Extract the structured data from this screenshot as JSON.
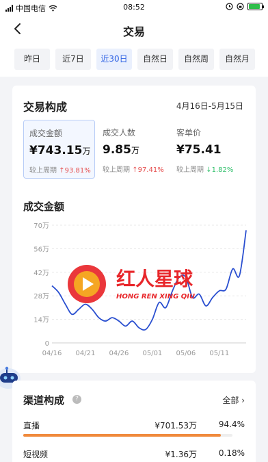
{
  "status_bar": {
    "carrier": "中国电信",
    "time": "08:52"
  },
  "nav": {
    "title": "交易"
  },
  "tabs": [
    {
      "label": "昨日",
      "active": false
    },
    {
      "label": "近7日",
      "active": false
    },
    {
      "label": "近30日",
      "active": true
    },
    {
      "label": "自然日",
      "active": false
    },
    {
      "label": "自然周",
      "active": false
    },
    {
      "label": "自然月",
      "active": false
    }
  ],
  "composition": {
    "title": "交易构成",
    "date_range": "4月16日-5月15日",
    "metrics": [
      {
        "label": "成交金额",
        "value": "¥743.15",
        "unit": "万",
        "compare_label": "较上周期",
        "direction": "up",
        "change": "93.81%",
        "selected": true
      },
      {
        "label": "成交人数",
        "value": "9.85",
        "unit": "万",
        "compare_label": "较上周期",
        "direction": "up",
        "change": "97.41%",
        "selected": false
      },
      {
        "label": "客单价",
        "value": "¥75.41",
        "unit": "",
        "compare_label": "较上周期",
        "direction": "down",
        "change": "1.82%",
        "selected": false
      }
    ]
  },
  "chart_data": {
    "type": "line",
    "title": "成交金额",
    "y_tick_labels": [
      "0",
      "14万",
      "28万",
      "42万",
      "56万",
      "70万"
    ],
    "x_tick_labels": [
      "04/16",
      "04/21",
      "04/26",
      "05/01",
      "05/06",
      "05/11"
    ],
    "ylim": [
      0,
      70
    ],
    "y_unit": "万",
    "x": [
      "04/16",
      "04/17",
      "04/18",
      "04/19",
      "04/20",
      "04/21",
      "04/22",
      "04/23",
      "04/24",
      "04/25",
      "04/26",
      "04/27",
      "04/28",
      "04/29",
      "04/30",
      "05/01",
      "05/02",
      "05/03",
      "05/04",
      "05/05",
      "05/06",
      "05/07",
      "05/08",
      "05/09",
      "05/10",
      "05/11",
      "05/12",
      "05/13",
      "05/14",
      "05/15"
    ],
    "series": [
      {
        "values": [
          34,
          30,
          23,
          17,
          20,
          23,
          20,
          15,
          13,
          15,
          13,
          10,
          13,
          9,
          8,
          14,
          24,
          21,
          31,
          39,
          39,
          27,
          29,
          22,
          27,
          31,
          32,
          44,
          40,
          67
        ]
      }
    ],
    "grid": true,
    "line_color": "#2a4fd0"
  },
  "watermark": {
    "text": "红人星球",
    "subtext": "HONG REN XING QIU"
  },
  "channels": {
    "title": "渠道构成",
    "help_icon": "question-icon",
    "all_label": "全部",
    "rows": [
      {
        "name": "直播",
        "amount": "¥701.53万",
        "share": "94.4%",
        "share_value": 0.944
      },
      {
        "name": "短视频",
        "amount": "¥1.36万",
        "share": "0.18%",
        "share_value": 0.0018
      }
    ]
  }
}
